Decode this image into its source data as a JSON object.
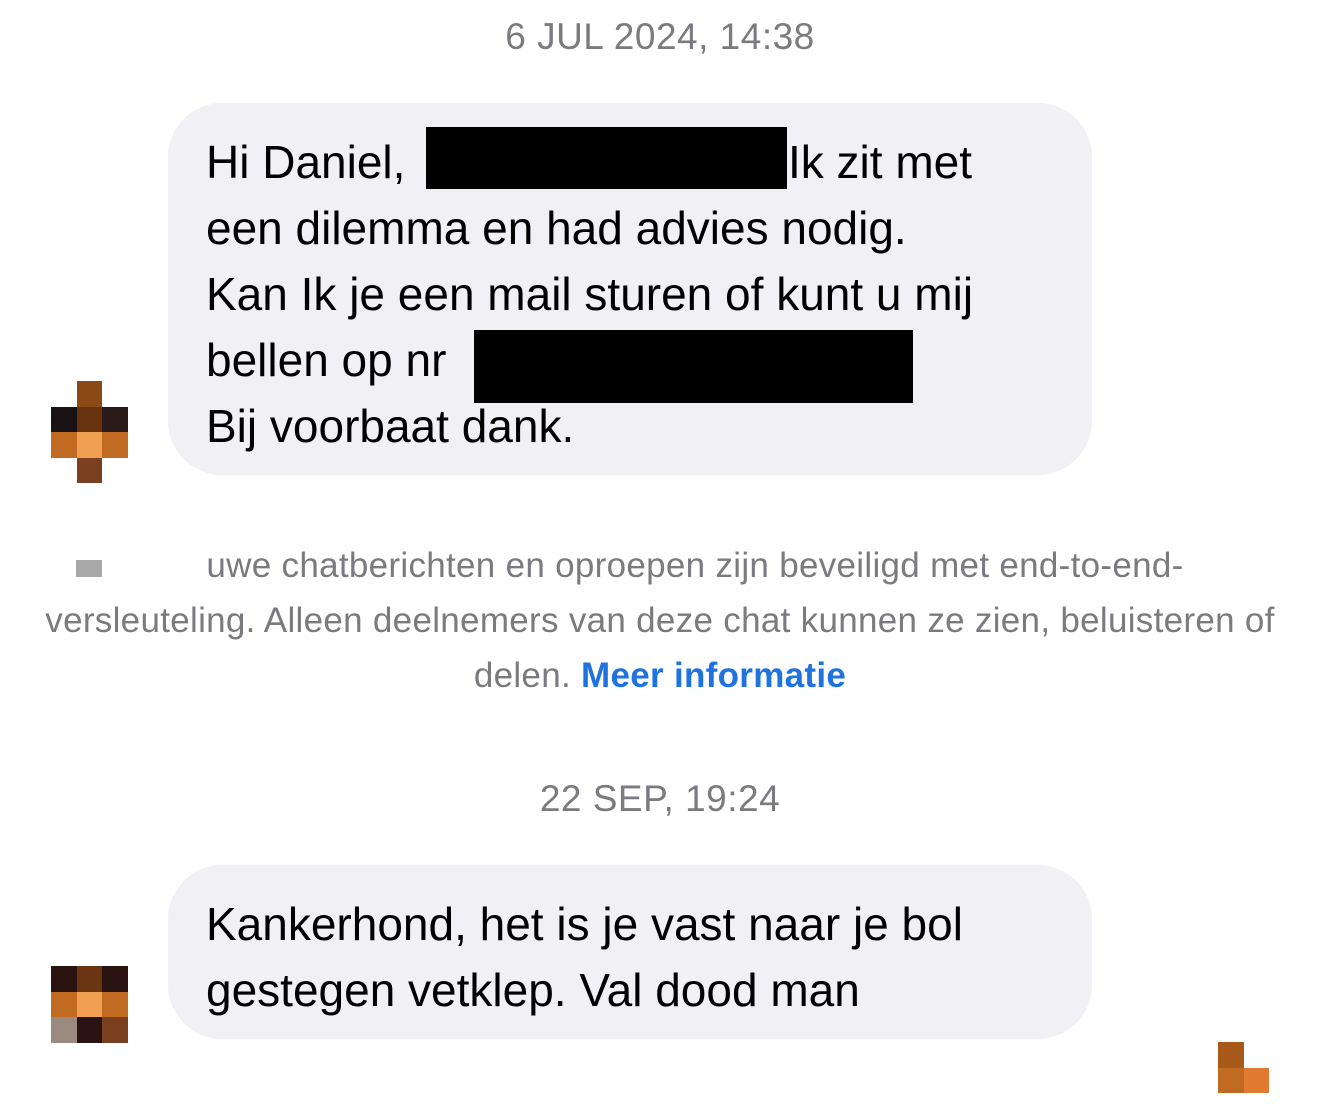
{
  "messages": [
    {
      "timestamp": "6 JUL 2024, 14:38",
      "lines": [
        "Hi Daniel,",
        "Ik zit met",
        "een dilemma en had advies nodig.",
        "Kan Ik je een mail sturen of kunt u mij",
        "bellen op nr",
        "Bij voorbaat dank."
      ]
    },
    {
      "timestamp": "22 SEP, 19:24",
      "lines": [
        "Kankerhond, het is je vast naar je bol",
        "gestegen vetklep. Val dood man"
      ]
    }
  ],
  "notice": {
    "text": "uwe chatberichten en oproepen zijn beveiligd met end-to-end-versleuteling. Alleen deelnemers van deze chat kunnen ze zien, beluisteren of delen.",
    "link": "Meer informatie"
  },
  "colors": {
    "bubble": "#f0f0f5",
    "timestamp": "#7a7a80",
    "link": "#1e73e0"
  }
}
